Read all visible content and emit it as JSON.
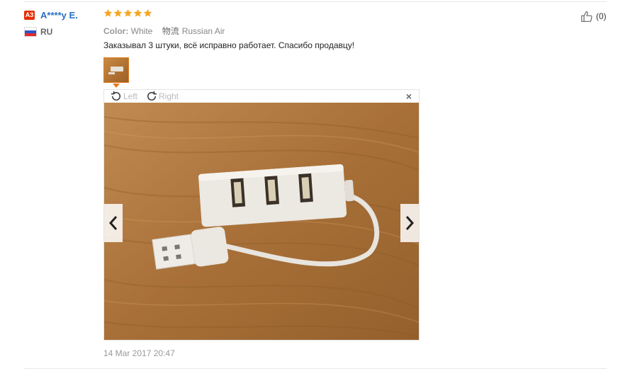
{
  "reviewer": {
    "level_badge": "A3",
    "name": "A****y E.",
    "country_code": "RU"
  },
  "rating": {
    "stars": 5,
    "max": 5,
    "color": "#f5a623"
  },
  "order_info": {
    "color_label": "Color:",
    "color_value": "White",
    "shipping_label": "物流",
    "shipping_value": "Russian Air"
  },
  "review": {
    "text": "Заказывал 3 штуки, всё исправно работает. Спасибо продавцу!",
    "date": "14 Mar 2017 20:47"
  },
  "viewer": {
    "rotate_left_label": "Left",
    "rotate_right_label": "Right",
    "close_glyph": "×"
  },
  "helpful": {
    "count": "(0)"
  },
  "colors": {
    "name_link": "#2a6fc5",
    "badge": "#e62e04",
    "thumb_border": "#e07b20"
  }
}
